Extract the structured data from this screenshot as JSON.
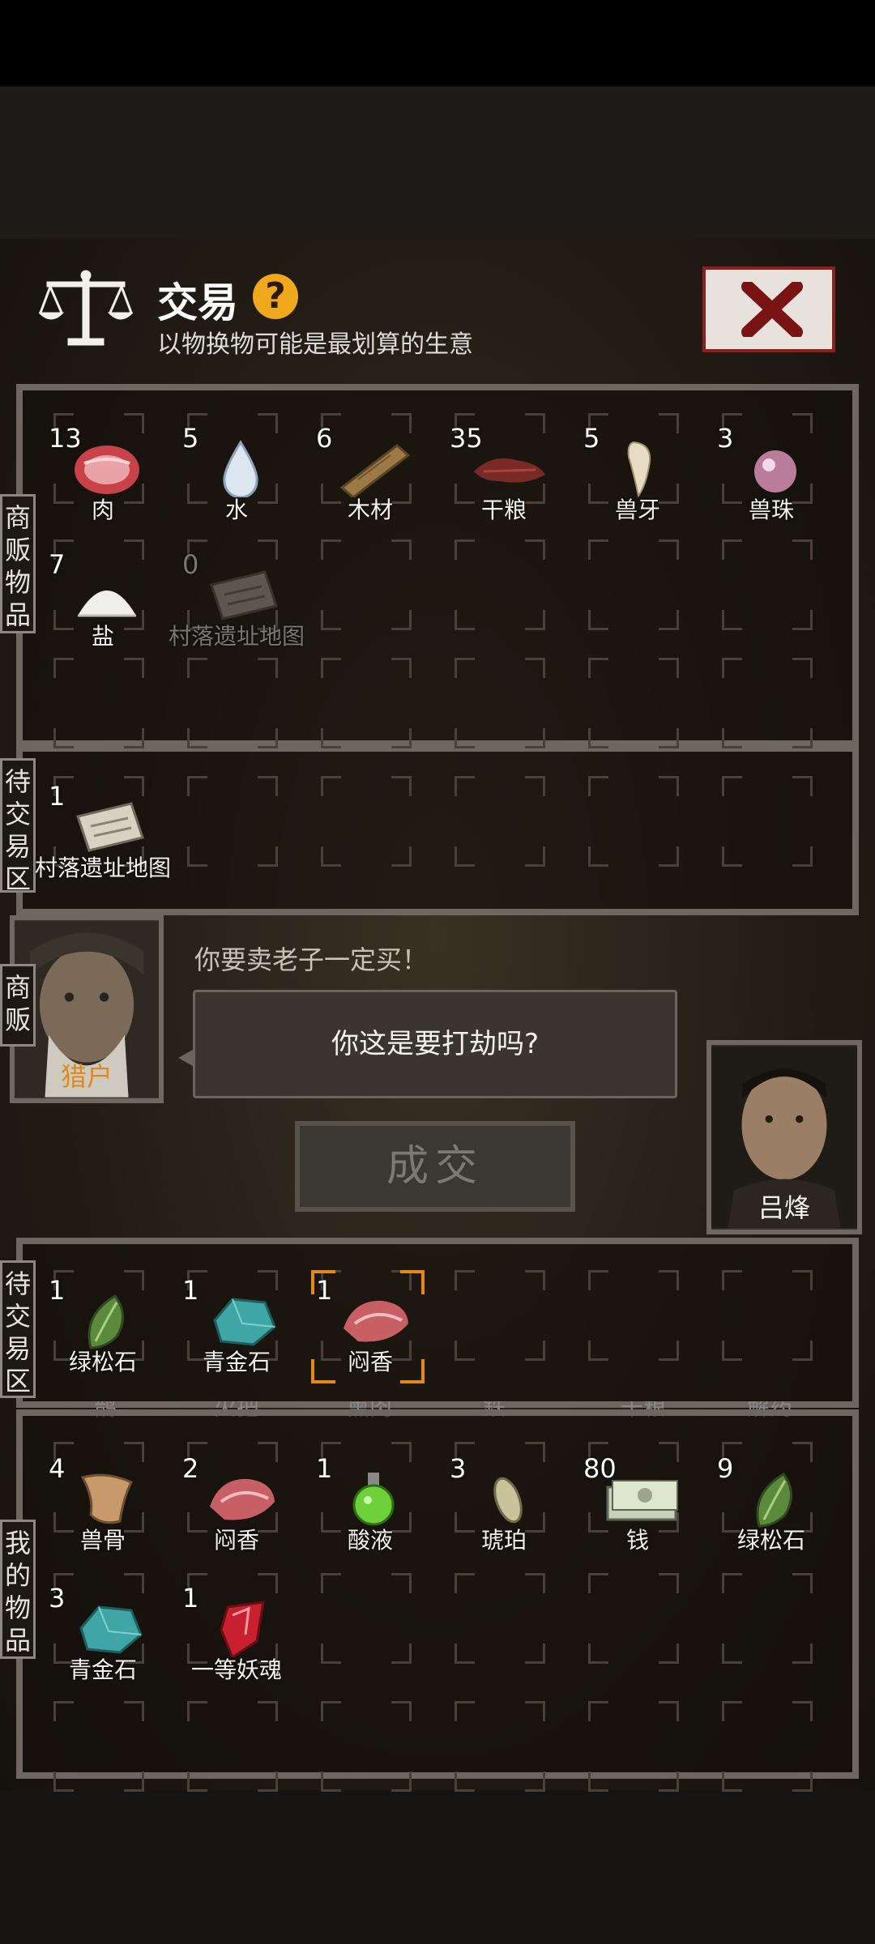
{
  "header": {
    "title": "交易",
    "help_icon": "?",
    "subtitle": "以物换物可能是最划算的生意"
  },
  "labels": {
    "merchant_goods": "商贩物品",
    "pending_trade_top": "待交易区",
    "merchant": "商贩",
    "pending_trade_bottom": "待交易区",
    "my_goods": "我的物品"
  },
  "merchant_items": [
    {
      "count": "13",
      "name": "肉",
      "icon": "meat-icon"
    },
    {
      "count": "5",
      "name": "水",
      "icon": "water-drop-icon"
    },
    {
      "count": "6",
      "name": "木材",
      "icon": "wood-icon"
    },
    {
      "count": "35",
      "name": "干粮",
      "icon": "jerky-icon"
    },
    {
      "count": "5",
      "name": "兽牙",
      "icon": "fang-icon"
    },
    {
      "count": "3",
      "name": "兽珠",
      "icon": "pearl-icon"
    },
    {
      "count": "7",
      "name": "盐",
      "icon": "salt-icon"
    },
    {
      "count": "0",
      "name": "村落遗址地图",
      "icon": "map-icon"
    }
  ],
  "merchant_pending": [
    {
      "count": "1",
      "name": "村落遗址地图",
      "icon": "map-icon"
    }
  ],
  "dialog": {
    "merchant_line": "你要卖老子一定买！",
    "bubble_text": "你这是要打劫吗?",
    "merchant_name": "猎户",
    "player_name": "吕烽",
    "deal_button": "成交"
  },
  "player_pending": [
    {
      "count": "1",
      "name": "绿松石",
      "icon": "turquoise-icon"
    },
    {
      "count": "1",
      "name": "青金石",
      "icon": "lapis-icon"
    },
    {
      "count": "1",
      "name": "闷香",
      "icon": "incense-meat-icon"
    }
  ],
  "hidden_row_partial": [
    "鹊",
    "火把",
    "熏肉",
    "鉄",
    "干粮",
    "解药"
  ],
  "player_items": [
    {
      "count": "4",
      "name": "兽骨",
      "icon": "bone-icon"
    },
    {
      "count": "2",
      "name": "闷香",
      "icon": "incense-meat-icon"
    },
    {
      "count": "1",
      "name": "酸液",
      "icon": "acid-flask-icon"
    },
    {
      "count": "3",
      "name": "琥珀",
      "icon": "amber-icon"
    },
    {
      "count": "80",
      "name": "钱",
      "icon": "money-icon"
    },
    {
      "count": "9",
      "name": "绿松石",
      "icon": "turquoise-icon"
    },
    {
      "count": "3",
      "name": "青金石",
      "icon": "lapis-icon"
    },
    {
      "count": "1",
      "name": "一等妖魂",
      "icon": "soul-crystal-icon"
    }
  ],
  "colors": {
    "accent_orange": "#e08a1b",
    "merchant_name_color": "#e08a1b",
    "close_red": "#8b1e1e",
    "help_yellow": "#f0a81d"
  }
}
